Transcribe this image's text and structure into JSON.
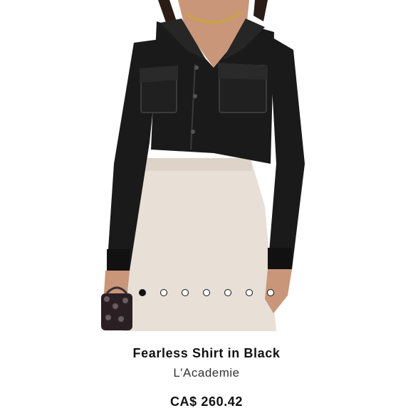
{
  "product": {
    "name": "Fearless Shirt in Black",
    "brand": "L'Academie",
    "price": "CA$ 260.42"
  },
  "carousel": {
    "total": 7,
    "active_index": 0
  },
  "colors": {
    "jacket": "#1a1a1a",
    "skirt": "#e8dfd6",
    "skin": "#c9967a",
    "background": "#ffffff"
  }
}
